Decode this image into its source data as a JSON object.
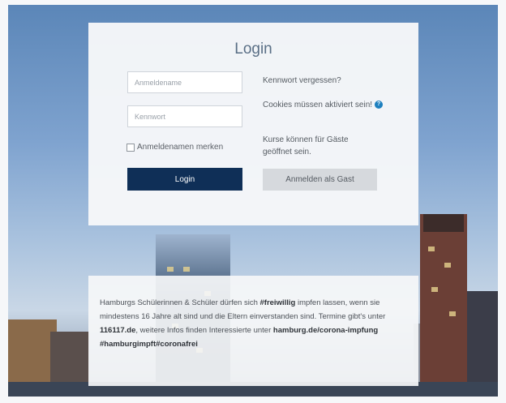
{
  "login": {
    "title": "Login",
    "username_placeholder": "Anmeldename",
    "password_placeholder": "Kennwort",
    "remember_label": "Anmeldenamen merken",
    "login_button": "Login",
    "forgot_password": "Kennwort vergessen?",
    "cookies_notice": "Cookies müssen aktiviert sein!",
    "guest_notice": "Kurse können für Gäste geöffnet sein.",
    "guest_button": "Anmelden als Gast"
  },
  "info": {
    "text_1": "Hamburgs Schülerinnen & Schüler dürfen sich ",
    "hashtag_1": "#freiwillig",
    "text_2": " impfen lassen, wenn sie mindestens 16 Jahre alt sind und die Eltern einverstanden sind. Termine gibt's unter ",
    "phone": "116117.de",
    "text_3": ", weitere Infos finden Interessierte unter ",
    "link": "hamburg.de/corona-impfung",
    "hashtag_2": "#hamburgimpft#coronafrei"
  },
  "icons": {
    "help": "question-circle-icon",
    "checkbox": "checkbox-icon"
  },
  "colors": {
    "primary_button": "#0f2f57",
    "secondary_button": "#d6d9dd",
    "help_icon": "#1d7fbf"
  }
}
